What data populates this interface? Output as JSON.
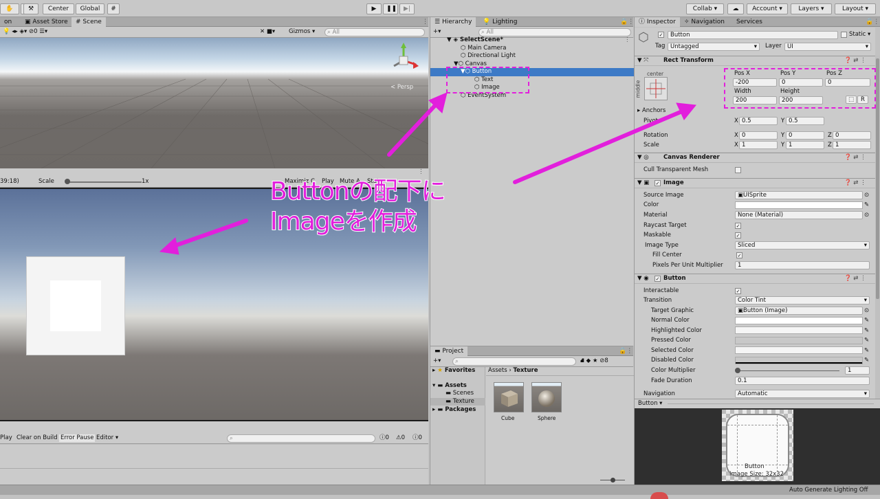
{
  "toolbar": {
    "partial_tool": "",
    "center": "Center",
    "global": "Global",
    "collab": "Collab ▾",
    "account": "Account ▾",
    "layers": "Layers ▾",
    "layout": "Layout ▾"
  },
  "scene": {
    "tabs": [
      "on",
      "Asset Store",
      "Scene"
    ],
    "gizmos": "Gizmos ▾",
    "search_placeholder": "All",
    "gizmo_count": "0",
    "persp": "< Persp"
  },
  "game": {
    "resolution": "39:18)",
    "scale_label": "Scale",
    "scale_value": "1x",
    "maximize": "Maximiz",
    "play": "Play",
    "mute": "Mute A",
    "stats": "Stats"
  },
  "console": {
    "play": "Play",
    "clear_on_build": "Clear on Build",
    "error_pause": "Error Pause",
    "editor": "Editor ▾",
    "counts": [
      "0",
      "0",
      "0"
    ]
  },
  "hierarchy": {
    "tabs": [
      "Hierarchy",
      "Lighting"
    ],
    "search_placeholder": "All",
    "items": [
      "SelectScene*",
      "Main Camera",
      "Directional Light",
      "Canvas",
      "Button",
      "Text",
      "Image",
      "EventSystem"
    ]
  },
  "project": {
    "tab": "Project",
    "breadcrumb": [
      "Assets",
      "Texture"
    ],
    "count": "8",
    "tree": [
      "Favorites",
      "Assets",
      "Scenes",
      "Texture",
      "Packages"
    ],
    "assets": [
      "Cube",
      "Sphere"
    ]
  },
  "annotation": {
    "line1": "Buttonの配下に",
    "line2": "Imageを作成"
  },
  "inspector": {
    "tabs": [
      "Inspector",
      "Navigation",
      "Services"
    ],
    "name": "Button",
    "static": "Static ▾",
    "tag_label": "Tag",
    "tag": "Untagged",
    "layer_label": "Layer",
    "layer": "UI",
    "rect": {
      "title": "Rect Transform",
      "anchor_h": "center",
      "anchor_v": "middle",
      "pos_x_label": "Pos X",
      "pos_y_label": "Pos Y",
      "pos_z_label": "Pos Z",
      "pos_x": "-200",
      "pos_y": "0",
      "pos_z": "0",
      "width_label": "Width",
      "height_label": "Height",
      "width": "200",
      "height": "200",
      "r_btn": "R",
      "anchors": "Anchors",
      "pivot": "Pivot",
      "pivot_x": "0.5",
      "pivot_y": "0.5",
      "rotation": "Rotation",
      "rot_x": "0",
      "rot_y": "0",
      "rot_z": "0",
      "scale": "Scale",
      "scale_x": "1",
      "scale_y": "1",
      "scale_z": "1"
    },
    "canvas_renderer": {
      "title": "Canvas Renderer",
      "cull": "Cull Transparent Mesh"
    },
    "image": {
      "title": "Image",
      "source_label": "Source Image",
      "source": "UISprite",
      "color_label": "Color",
      "material_label": "Material",
      "material": "None (Material)",
      "raycast": "Raycast Target",
      "maskable": "Maskable",
      "type_label": "Image Type",
      "type": "Sliced",
      "fill_center": "Fill Center",
      "ppu_label": "Pixels Per Unit Multiplier",
      "ppu": "1"
    },
    "button": {
      "title": "Button",
      "interactable": "Interactable",
      "transition_label": "Transition",
      "transition": "Color Tint",
      "target_label": "Target Graphic",
      "target": "Button (Image)",
      "normal": "Normal Color",
      "highlighted": "Highlighted Color",
      "pressed": "Pressed Color",
      "selected": "Selected Color",
      "disabled": "Disabled Color",
      "multiplier_label": "Color Multiplier",
      "multiplier": "1",
      "fade_label": "Fade Duration",
      "fade": "0.1",
      "navigation_label": "Navigation",
      "navigation": "Automatic"
    },
    "preview": {
      "title": "Button ▾",
      "caption": "Button",
      "size": "Image Size: 32x32"
    }
  },
  "status": {
    "text": "Auto Generate Lighting Off"
  },
  "colors": {
    "accent": "#e21fdc",
    "selection": "#3d7ac6"
  }
}
